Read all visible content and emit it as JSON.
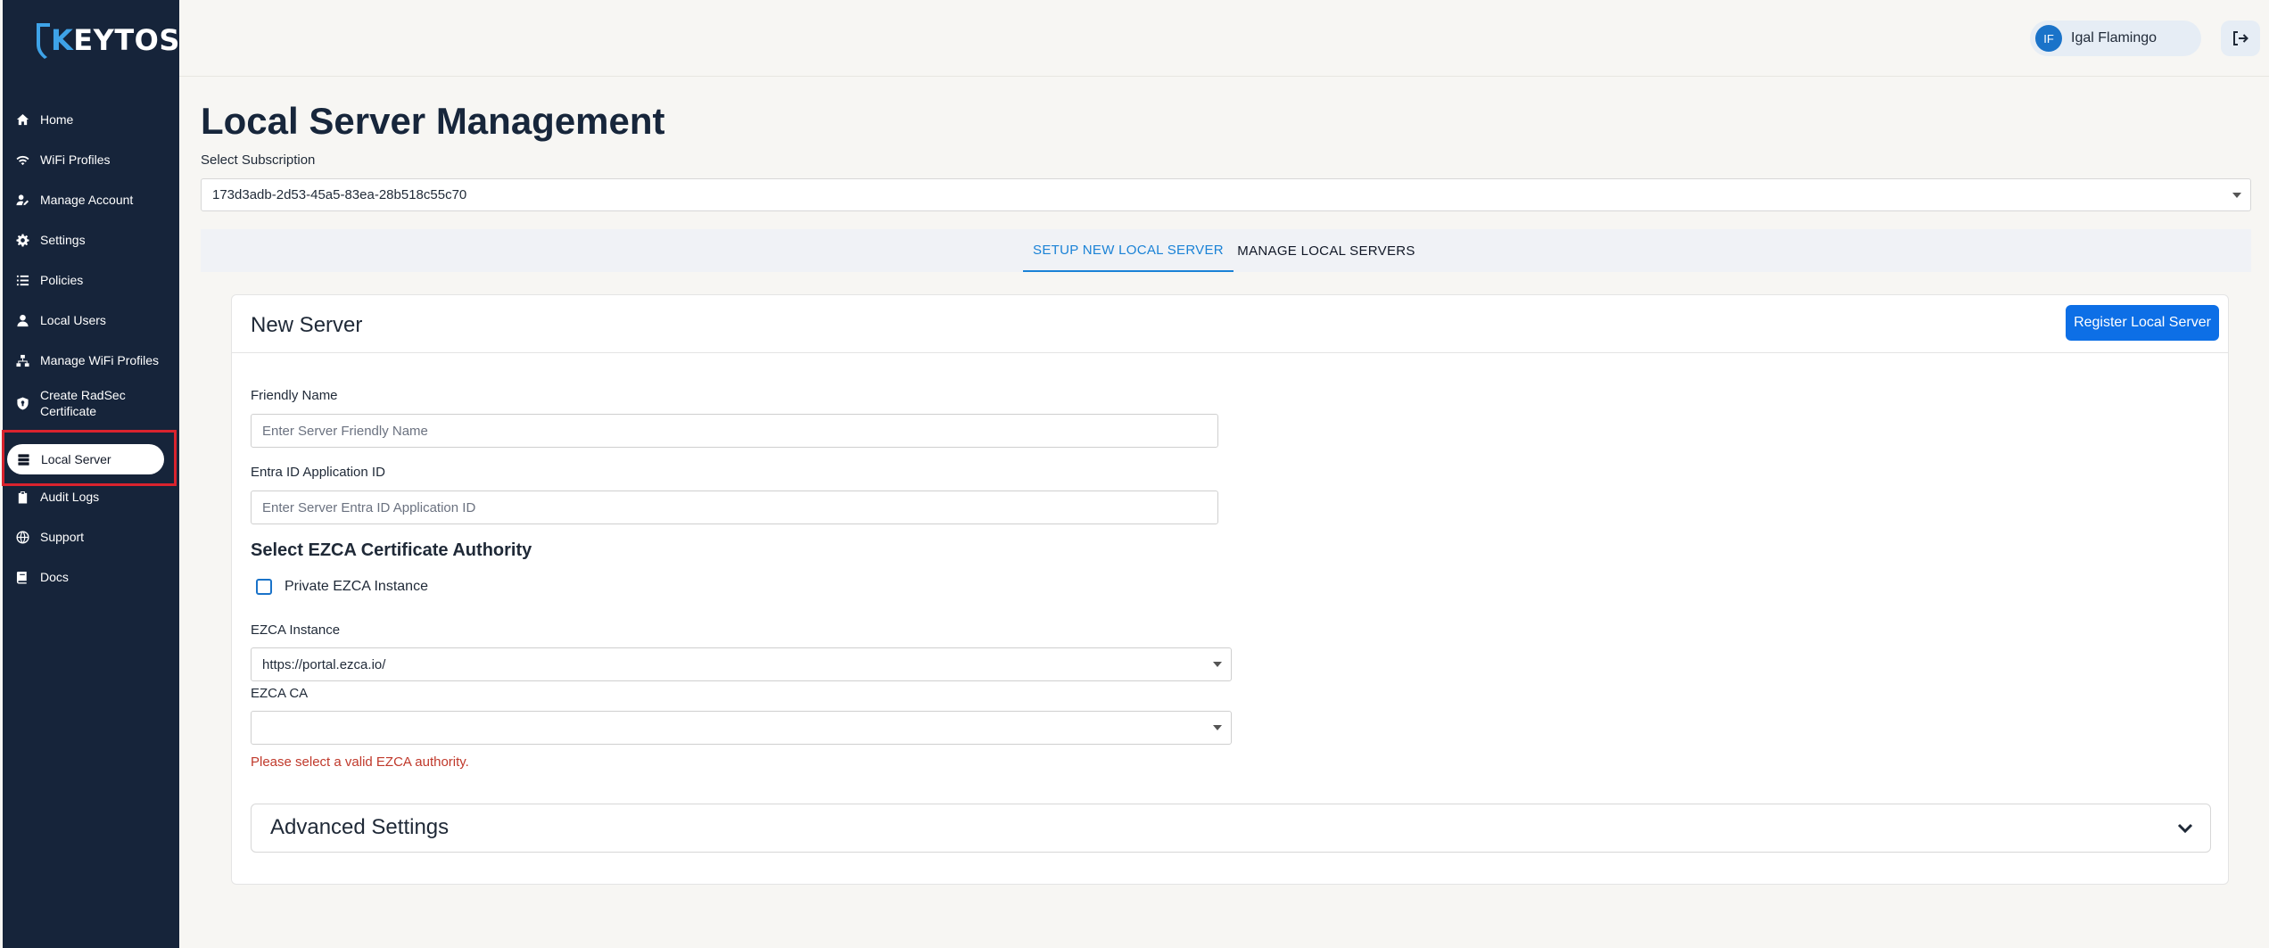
{
  "brand": {
    "prefix": "K",
    "name": "EYTOS"
  },
  "sidebar": {
    "items": [
      {
        "label": "Home",
        "icon": "home-icon"
      },
      {
        "label": "WiFi Profiles",
        "icon": "wifi-icon"
      },
      {
        "label": "Manage Account",
        "icon": "user-edit-icon"
      },
      {
        "label": "Settings",
        "icon": "gear-icon"
      },
      {
        "label": "Policies",
        "icon": "list-icon"
      },
      {
        "label": "Local Users",
        "icon": "user-icon"
      },
      {
        "label": "Manage WiFi Profiles",
        "icon": "network-icon"
      },
      {
        "label": "Create RadSec",
        "label2": "Certificate",
        "icon": "shield-icon"
      },
      {
        "label": "Local Server",
        "icon": "server-icon",
        "active": true
      },
      {
        "label": "Audit Logs",
        "icon": "clipboard-icon"
      },
      {
        "label": "Support",
        "icon": "globe-icon"
      },
      {
        "label": "Docs",
        "icon": "book-icon"
      }
    ]
  },
  "header": {
    "user_initials": "IF",
    "user_name": "Igal Flamingo"
  },
  "main": {
    "title": "Local Server Management",
    "subscription_label": "Select Subscription",
    "subscription_value": "173d3adb-2d53-45a5-83ea-28b518c55c70",
    "tabs": [
      {
        "label": "SETUP NEW LOCAL SERVER",
        "active": true
      },
      {
        "label": "MANAGE LOCAL SERVERS",
        "active": false
      }
    ]
  },
  "card": {
    "title": "New Server",
    "register_button": "Register Local Server",
    "friendly_name_label": "Friendly Name",
    "friendly_name_placeholder": "Enter Server Friendly Name",
    "app_id_label": "Entra ID Application ID",
    "app_id_placeholder": "Enter Server Entra ID Application ID",
    "ca_section_title": "Select EZCA Certificate Authority",
    "private_checkbox_label": "Private EZCA Instance",
    "instance_label": "EZCA Instance",
    "instance_value": "https://portal.ezca.io/",
    "ca_label": "EZCA CA",
    "ca_value": "",
    "error_text": "Please select a valid EZCA authority.",
    "advanced_title": "Advanced Settings"
  },
  "colors": {
    "sidebar_bg": "#16243a",
    "accent": "#1a82d6",
    "primary_button": "#0d6fe6",
    "error": "#c0392b",
    "highlight": "#d9232e"
  }
}
